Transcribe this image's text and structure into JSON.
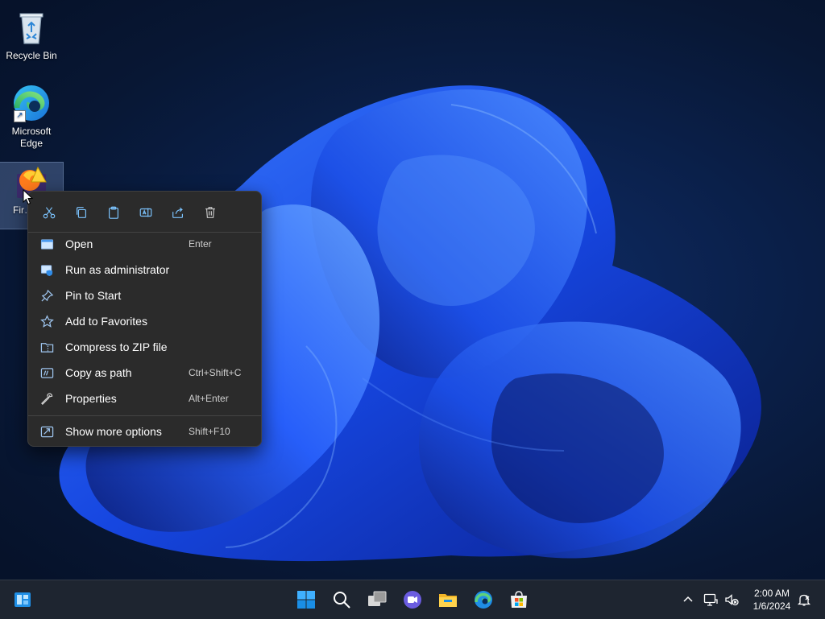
{
  "desktop": {
    "icons": [
      {
        "label": "Recycle Bin"
      },
      {
        "label": "Microsoft Edge"
      },
      {
        "label": "Fir… Ins…"
      }
    ]
  },
  "context_menu": {
    "toolbar": [
      {
        "name": "cut",
        "icon": "scissors-icon"
      },
      {
        "name": "copy",
        "icon": "copy-icon"
      },
      {
        "name": "paste",
        "icon": "paste-icon"
      },
      {
        "name": "rename",
        "icon": "rename-icon"
      },
      {
        "name": "share",
        "icon": "share-icon"
      },
      {
        "name": "delete",
        "icon": "trash-icon"
      }
    ],
    "items": [
      {
        "label": "Open",
        "shortcut": "Enter",
        "icon": "open-icon"
      },
      {
        "label": "Run as administrator",
        "shortcut": "",
        "icon": "shield-icon"
      },
      {
        "label": "Pin to Start",
        "shortcut": "",
        "icon": "pin-icon"
      },
      {
        "label": "Add to Favorites",
        "shortcut": "",
        "icon": "star-icon"
      },
      {
        "label": "Compress to ZIP file",
        "shortcut": "",
        "icon": "zip-folder-icon"
      },
      {
        "label": "Copy as path",
        "shortcut": "Ctrl+Shift+C",
        "icon": "path-icon"
      },
      {
        "label": "Properties",
        "shortcut": "Alt+Enter",
        "icon": "wrench-icon"
      },
      {
        "label": "Show more options",
        "shortcut": "Shift+F10",
        "icon": "more-options-icon"
      }
    ]
  },
  "taskbar": {
    "apps": [
      "widgets-icon",
      "start-icon",
      "search-icon",
      "task-view-icon",
      "chat-icon",
      "file-explorer-icon",
      "edge-icon",
      "store-icon"
    ],
    "tray": [
      "chevron-up-icon",
      "network-icon",
      "volume-muted-icon",
      "notification-icon"
    ],
    "clock": {
      "time": "2:00 AM",
      "date": "1/6/2024"
    }
  },
  "colors": {
    "accent": "#0078d4",
    "menu_bg": "#2b2b2b",
    "taskbar_bg": "#1e2530"
  }
}
